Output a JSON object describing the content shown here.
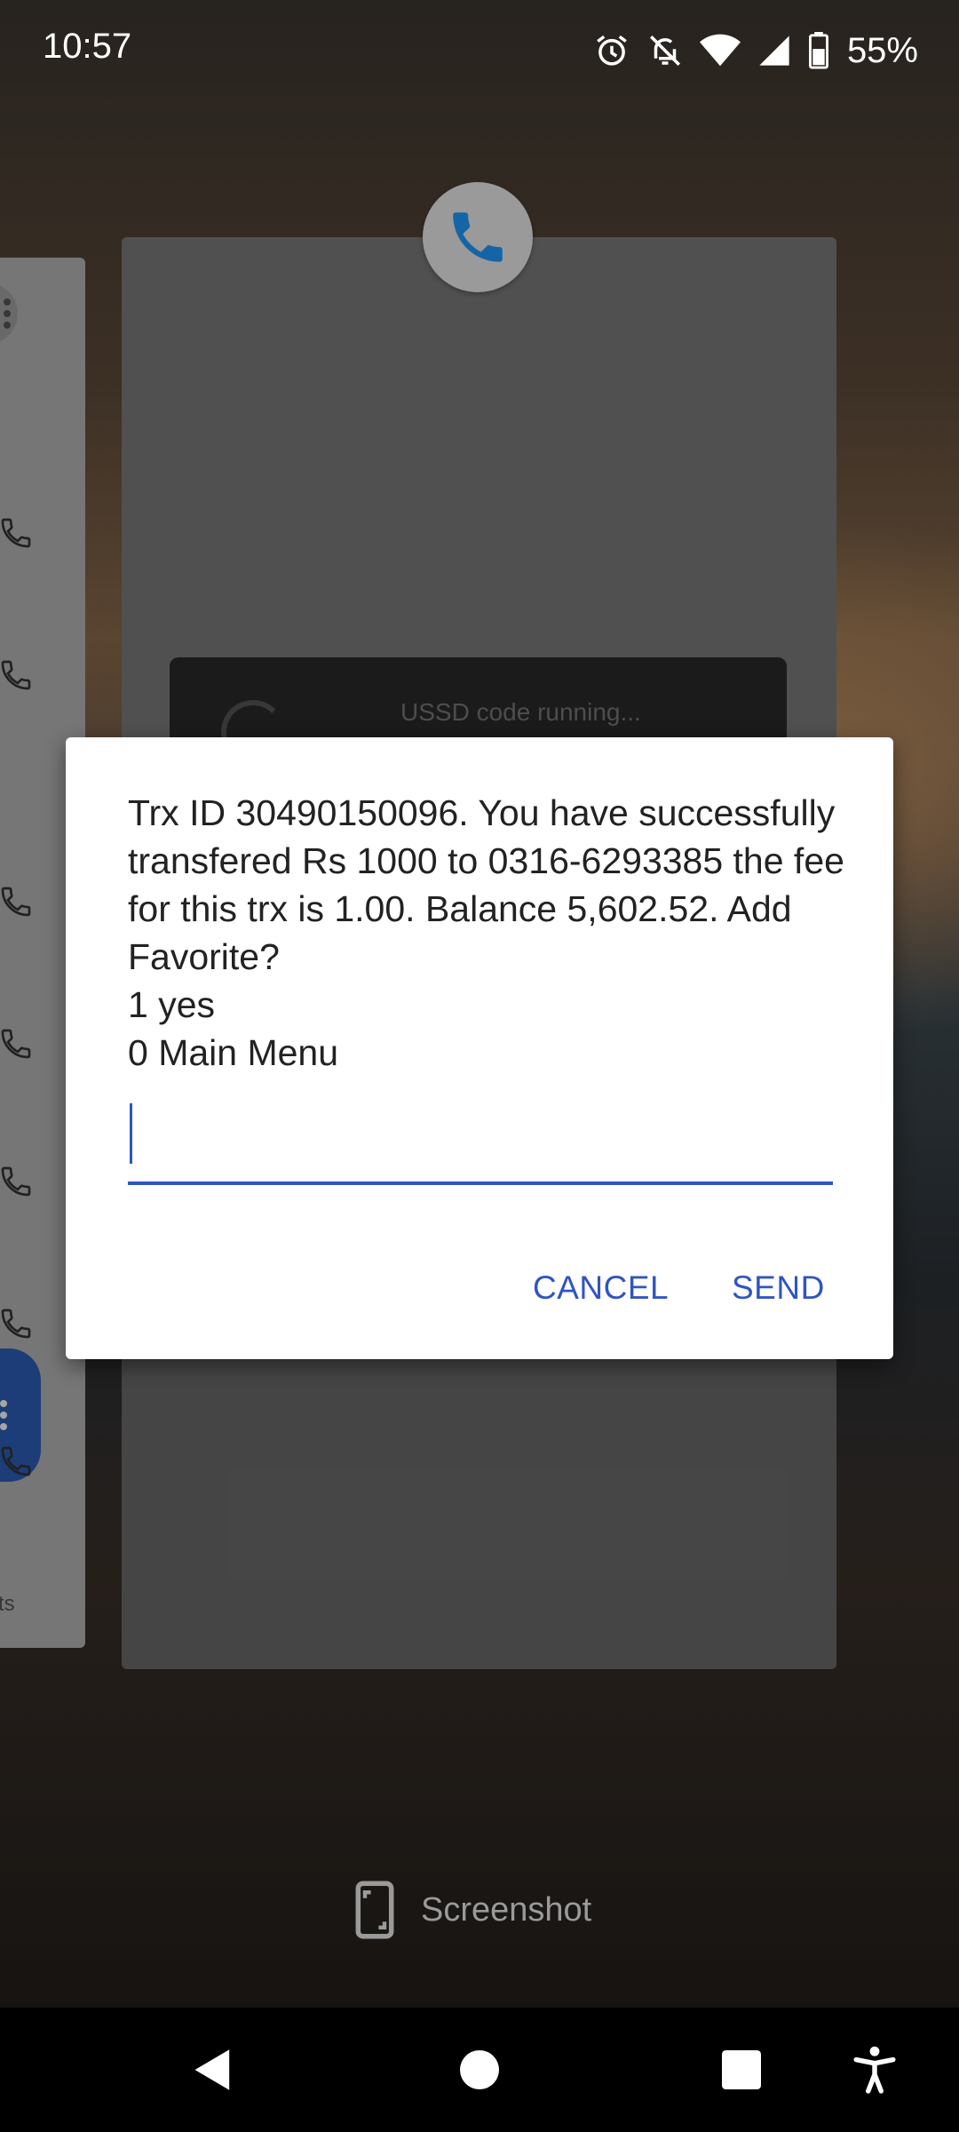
{
  "status_bar": {
    "time": "10:57",
    "battery_percent": "55%",
    "icons": [
      "alarm-icon",
      "notifications-off-icon",
      "wifi-icon",
      "cell-signal-icon",
      "battery-icon"
    ]
  },
  "recents": {
    "main_card": {
      "app_icon": "phone-icon",
      "toast_text": "USSD code running..."
    },
    "left_card": {
      "footer_text": "ts"
    }
  },
  "dialog": {
    "message": "Trx ID 30490150096. You have successfully transfered Rs 1000 to 0316-6293385 the fee for this trx is 1.00. Balance 5,602.52. Add Favorite?\n1 yes\n0 Main Menu",
    "input_value": "",
    "input_placeholder": "",
    "cancel_label": "CANCEL",
    "send_label": "SEND",
    "accent_color": "#2f55c2"
  },
  "screenshot_action": {
    "label": "Screenshot",
    "icon": "screenshot-icon"
  },
  "navigation": {
    "back": "back-icon",
    "home": "home-icon",
    "recents": "recents-icon",
    "accessibility": "accessibility-icon"
  }
}
